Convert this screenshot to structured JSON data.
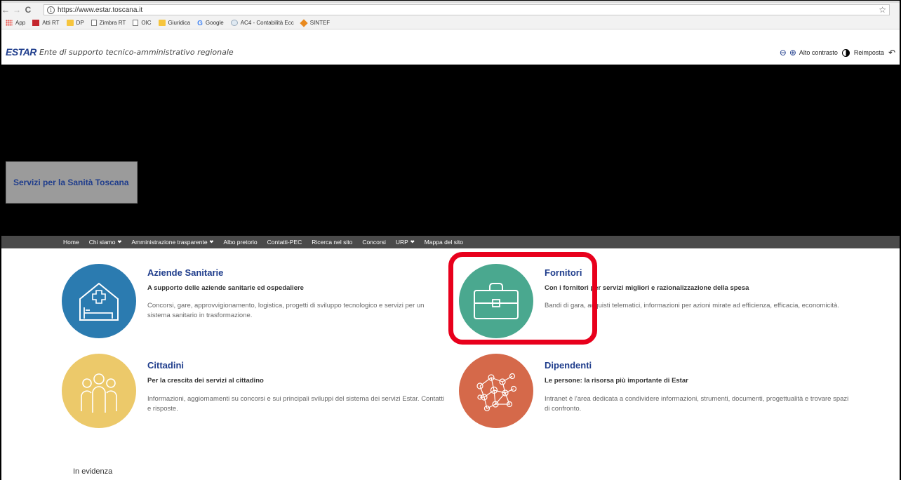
{
  "browser": {
    "url": "https://www.estar.toscana.it",
    "bookmarks": [
      {
        "label": "App",
        "icon": "apps-icon"
      },
      {
        "label": "Atti RT",
        "icon": "red-square-icon"
      },
      {
        "label": "DP",
        "icon": "folder-icon"
      },
      {
        "label": "Zimbra RT",
        "icon": "page-icon"
      },
      {
        "label": "OIC",
        "icon": "page-icon"
      },
      {
        "label": "Giuridica",
        "icon": "folder-icon"
      },
      {
        "label": "Google",
        "icon": "google-icon"
      },
      {
        "label": "AC4 - Contabilità Ecc",
        "icon": "ac4-icon"
      },
      {
        "label": "SINTEF",
        "icon": "diamond-icon"
      }
    ]
  },
  "header": {
    "logo": "ESTAR",
    "tagline": "Ente di supporto tecnico-amministrativo regionale",
    "high_contrast": "Alto contrasto",
    "reset": "Reimposta"
  },
  "hero": {
    "box_text": "Servizi per la Sanità Toscana"
  },
  "nav": {
    "items": [
      {
        "label": "Home",
        "dropdown": false
      },
      {
        "label": "Chi siamo",
        "dropdown": true
      },
      {
        "label": "Amministrazione trasparente",
        "dropdown": true
      },
      {
        "label": "Albo pretorio",
        "dropdown": false
      },
      {
        "label": "Contatti-PEC",
        "dropdown": false
      },
      {
        "label": "Ricerca nel sito",
        "dropdown": false
      },
      {
        "label": "Concorsi",
        "dropdown": false
      },
      {
        "label": "URP",
        "dropdown": true
      },
      {
        "label": "Mappa del sito",
        "dropdown": false
      }
    ]
  },
  "cards": {
    "aziende": {
      "title": "Aziende Sanitarie",
      "subtitle": "A supporto delle aziende sanitarie ed ospedaliere",
      "description": "Concorsi, gare, approvvigionamento, logistica, progetti di sviluppo tecnologico e servizi per un sistema sanitario in trasformazione.",
      "color": "#2b7bb0"
    },
    "fornitori": {
      "title": "Fornitori",
      "subtitle": "Con i fornitori per servizi migliori e razionalizzazione della spesa",
      "description": "Bandi di gara, acquisti telematici, informazioni per azioni mirate ad efficienza, efficacia, economicità.",
      "color": "#4aa88f"
    },
    "cittadini": {
      "title": "Cittadini",
      "subtitle": "Per la crescita dei servizi al cittadino",
      "description": "Informazioni, aggiornamenti su concorsi e sui principali sviluppi del sistema dei servizi Estar. Contatti e risposte.",
      "color": "#ecc96a"
    },
    "dipendenti": {
      "title": "Dipendenti",
      "subtitle": "Le persone: la risorsa più importante di Estar",
      "description": "Intranet è l'area dedicata a condividere informazioni, strumenti, documenti, progettualità e trovare spazi di confronto.",
      "color": "#d5694a"
    }
  },
  "footer": {
    "in_evidenza": "In evidenza"
  },
  "highlight_color": "#e8001c"
}
